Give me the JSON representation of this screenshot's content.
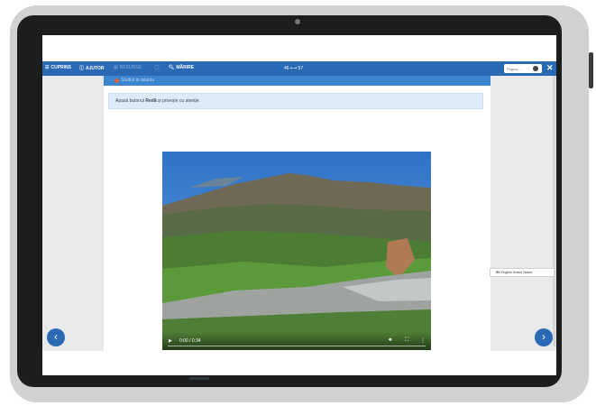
{
  "toolbar": {
    "contents_label": "CUPRINS",
    "help_label": "AJUTOR",
    "resources_label": "RESURSE",
    "magnify_label": "MĂRIRE",
    "pages_indicator": "46 ⟷ 57",
    "search_placeholder": "Pagina..."
  },
  "section": {
    "title": "Studiul in talanta"
  },
  "instruction": {
    "prefix": "Apasă butonul",
    "bold": "Redă",
    "suffix": "și privește cu atenție."
  },
  "video": {
    "time": "0:00 / 0:34"
  },
  "language_select": {
    "selected": "EN English United States"
  },
  "colors": {
    "brand": "#2a6ab5",
    "section": "#3b86cf",
    "instruction_bg": "#dcecf7"
  }
}
